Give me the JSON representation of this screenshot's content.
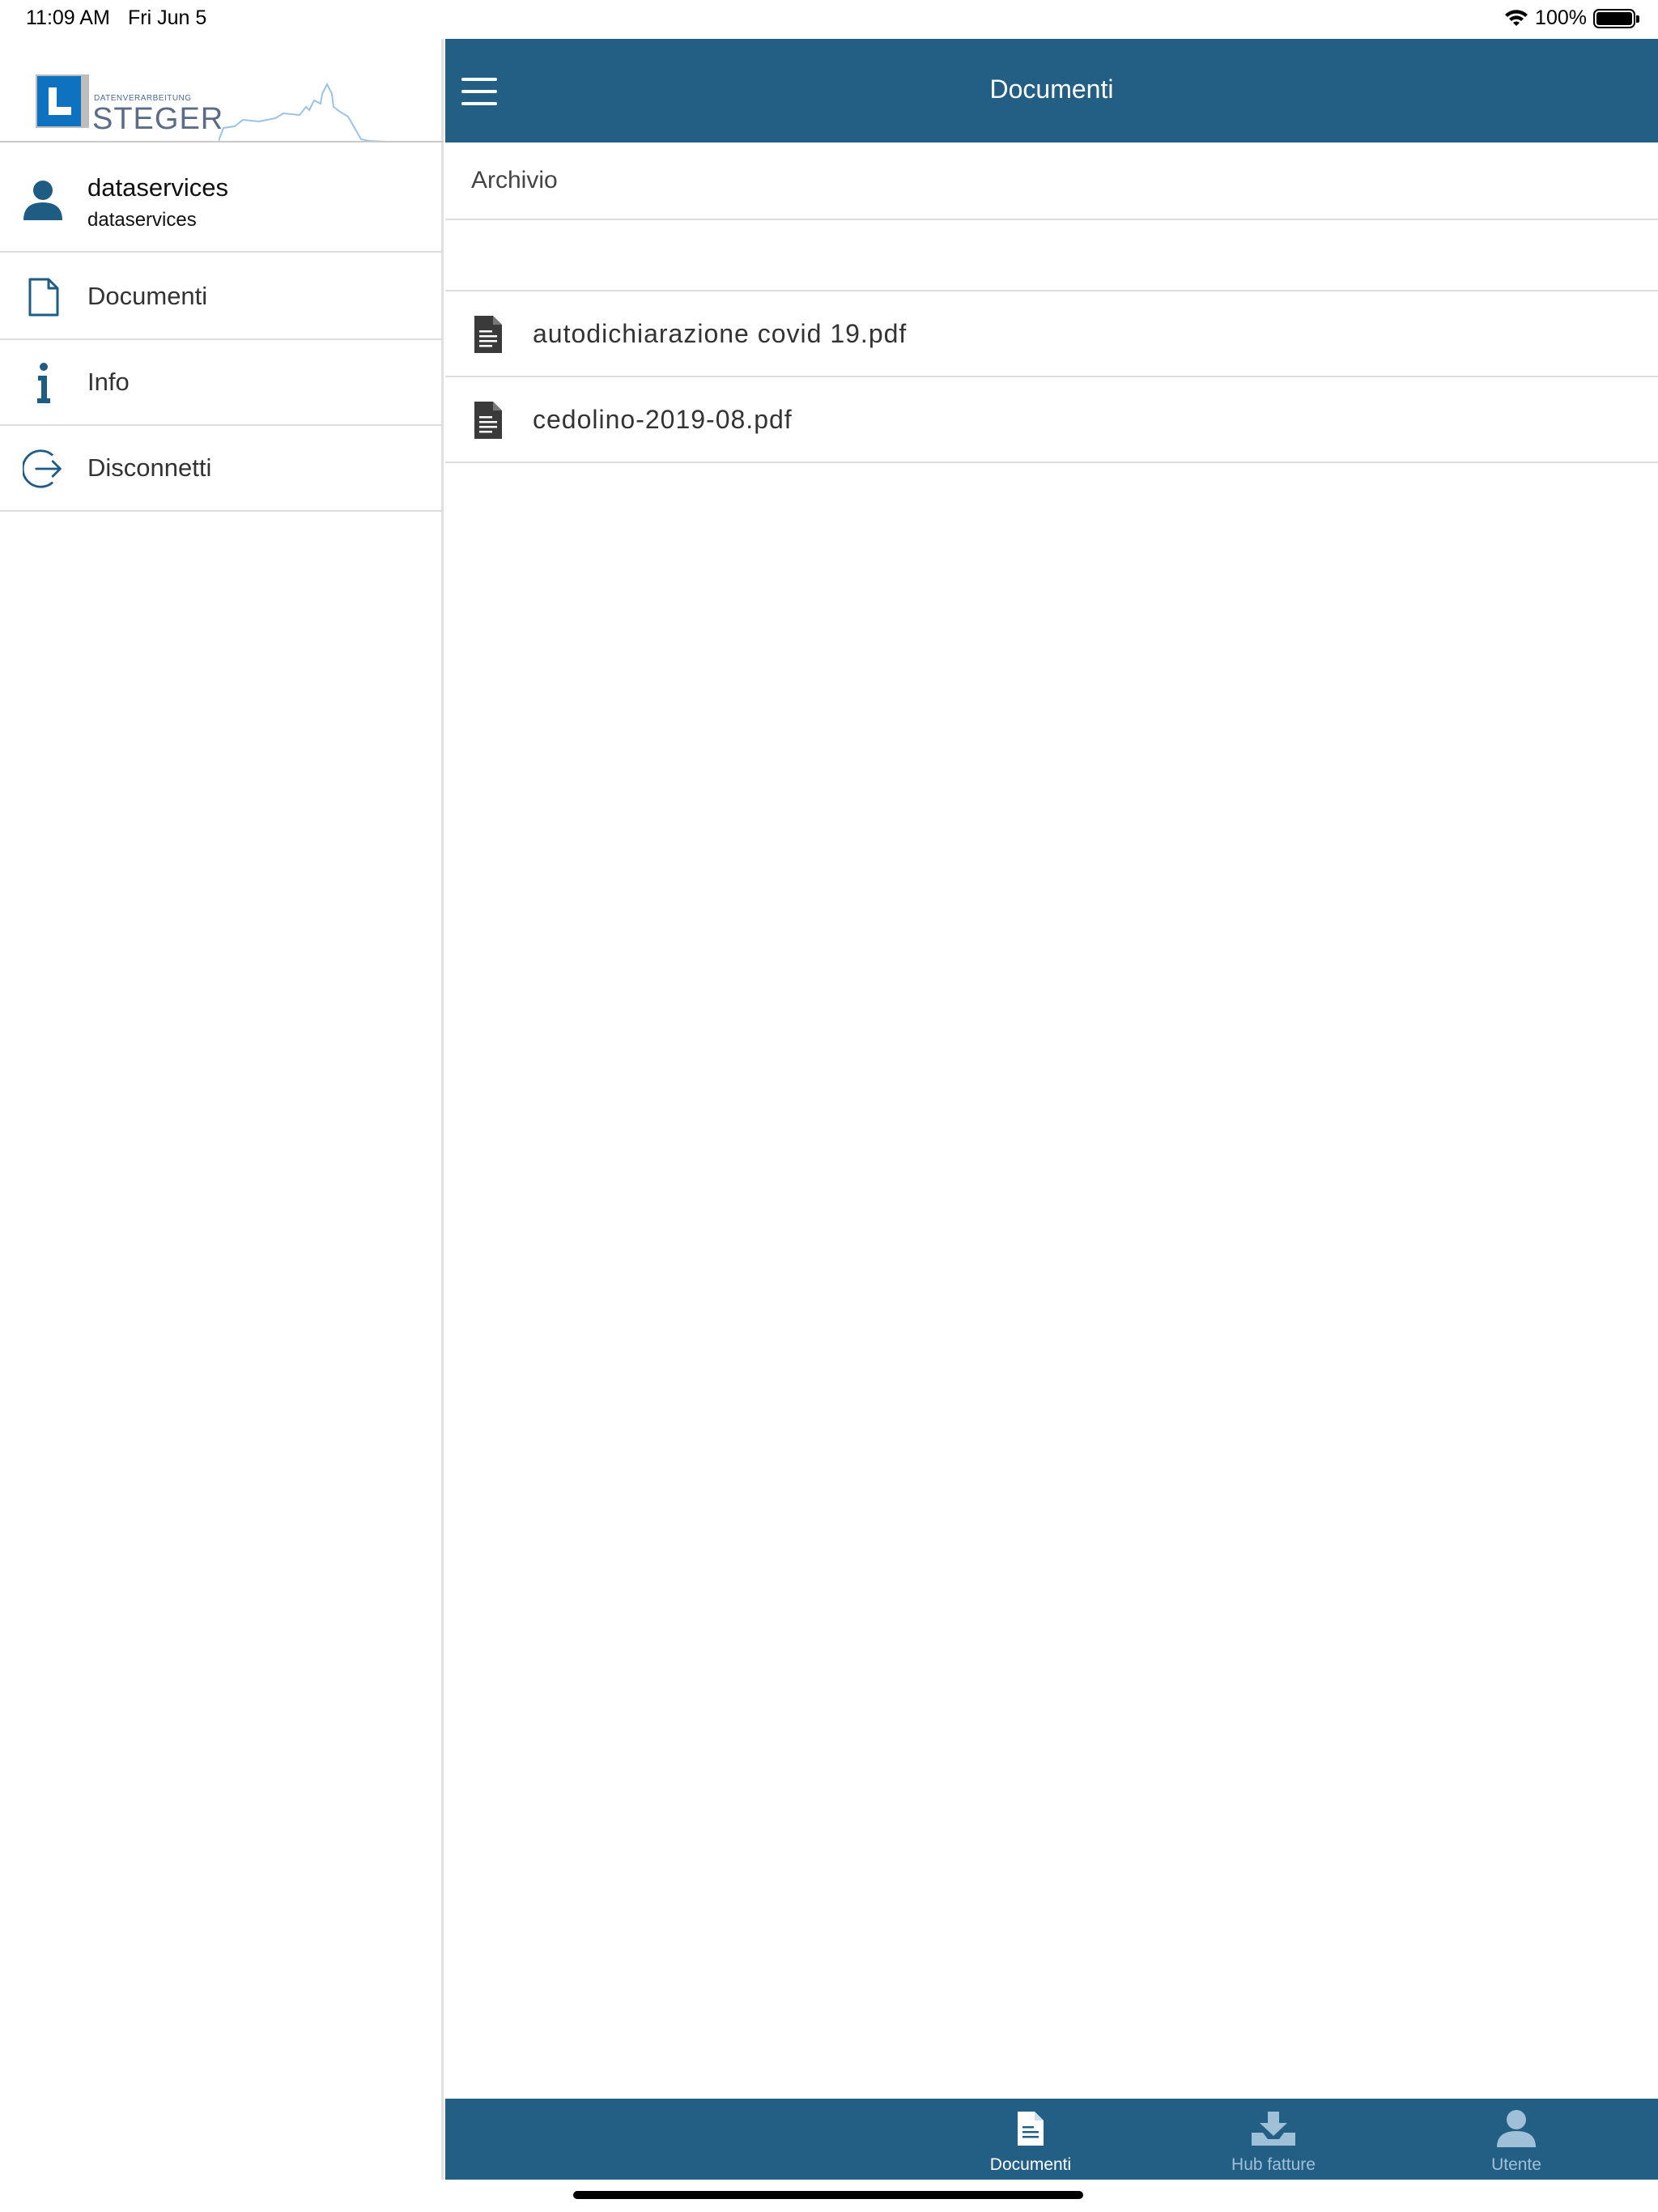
{
  "status_bar": {
    "time": "11:09 AM",
    "date": "Fri Jun 5",
    "battery": "100%"
  },
  "logo": {
    "small_text": "DATENVERARBEITUNG",
    "big_text": "STEGER"
  },
  "user": {
    "name": "dataservices",
    "subtitle": "dataservices"
  },
  "menu": {
    "items": [
      {
        "label": "Documenti",
        "icon": "document-icon"
      },
      {
        "label": "Info",
        "icon": "info-icon"
      },
      {
        "label": "Disconnetti",
        "icon": "logout-icon"
      }
    ]
  },
  "header": {
    "title": "Documenti"
  },
  "breadcrumb": "Archivio",
  "files": [
    {
      "name": "autodichiarazione covid 19.pdf",
      "icon": "file-icon"
    },
    {
      "name": "cedolino-2019-08.pdf",
      "icon": "file-icon"
    }
  ],
  "tabs": [
    {
      "label": "Documenti",
      "icon": "document-icon",
      "active": true
    },
    {
      "label": "Hub fatture",
      "icon": "inbox-download-icon",
      "active": false
    },
    {
      "label": "Utente",
      "icon": "user-icon",
      "active": false
    }
  ],
  "colors": {
    "primary": "#235e84",
    "accent_icon": "#1f5c84",
    "tab_inactive": "#9fc0d6"
  }
}
